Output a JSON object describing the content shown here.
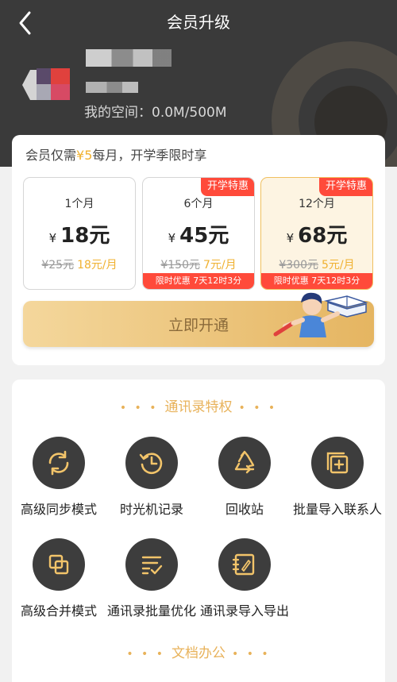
{
  "header": {
    "title": "会员升级",
    "space_label": "我的空间：0.0M/500M"
  },
  "promo": {
    "prefix": "会员仅需",
    "price": "¥5",
    "suffix": "每月，开学季限时享"
  },
  "plans": [
    {
      "months": "1个月",
      "currency": "¥",
      "price": "18元",
      "original": "¥25元",
      "per_month": "18元/月",
      "badge": "",
      "countdown": "",
      "selected": false
    },
    {
      "months": "6个月",
      "currency": "¥",
      "price": "45元",
      "original": "¥150元",
      "per_month": "7元/月",
      "badge": "开学特惠",
      "countdown": "限时优惠 7天12时3分",
      "selected": false
    },
    {
      "months": "12个月",
      "currency": "¥",
      "price": "68元",
      "original": "¥300元",
      "per_month": "5元/月",
      "badge": "开学特惠",
      "countdown": "限时优惠 7天12时3分",
      "selected": true
    }
  ],
  "buy_button": {
    "label": "立即开通"
  },
  "sections": [
    {
      "title": "通讯录特权",
      "features": [
        {
          "label": "高级同步模式",
          "icon": "sync-icon"
        },
        {
          "label": "时光机记录",
          "icon": "history-clock-icon"
        },
        {
          "label": "回收站",
          "icon": "recycle-icon"
        },
        {
          "label": "批量导入联系人",
          "icon": "batch-import-icon"
        },
        {
          "label": "高级合并模式",
          "icon": "merge-icon"
        },
        {
          "label": "通讯录批量优化",
          "icon": "optimize-list-icon"
        },
        {
          "label": "通讯录导入导出",
          "icon": "import-export-icon"
        }
      ]
    },
    {
      "title": "文档办公",
      "features": []
    }
  ],
  "colors": {
    "header_bg": "#3a3a3a",
    "accent_gold": "#f0b130",
    "badge_red": "#ff4a3a",
    "button_gold": "#e5b561",
    "icon_circle": "#3d3d3d"
  }
}
